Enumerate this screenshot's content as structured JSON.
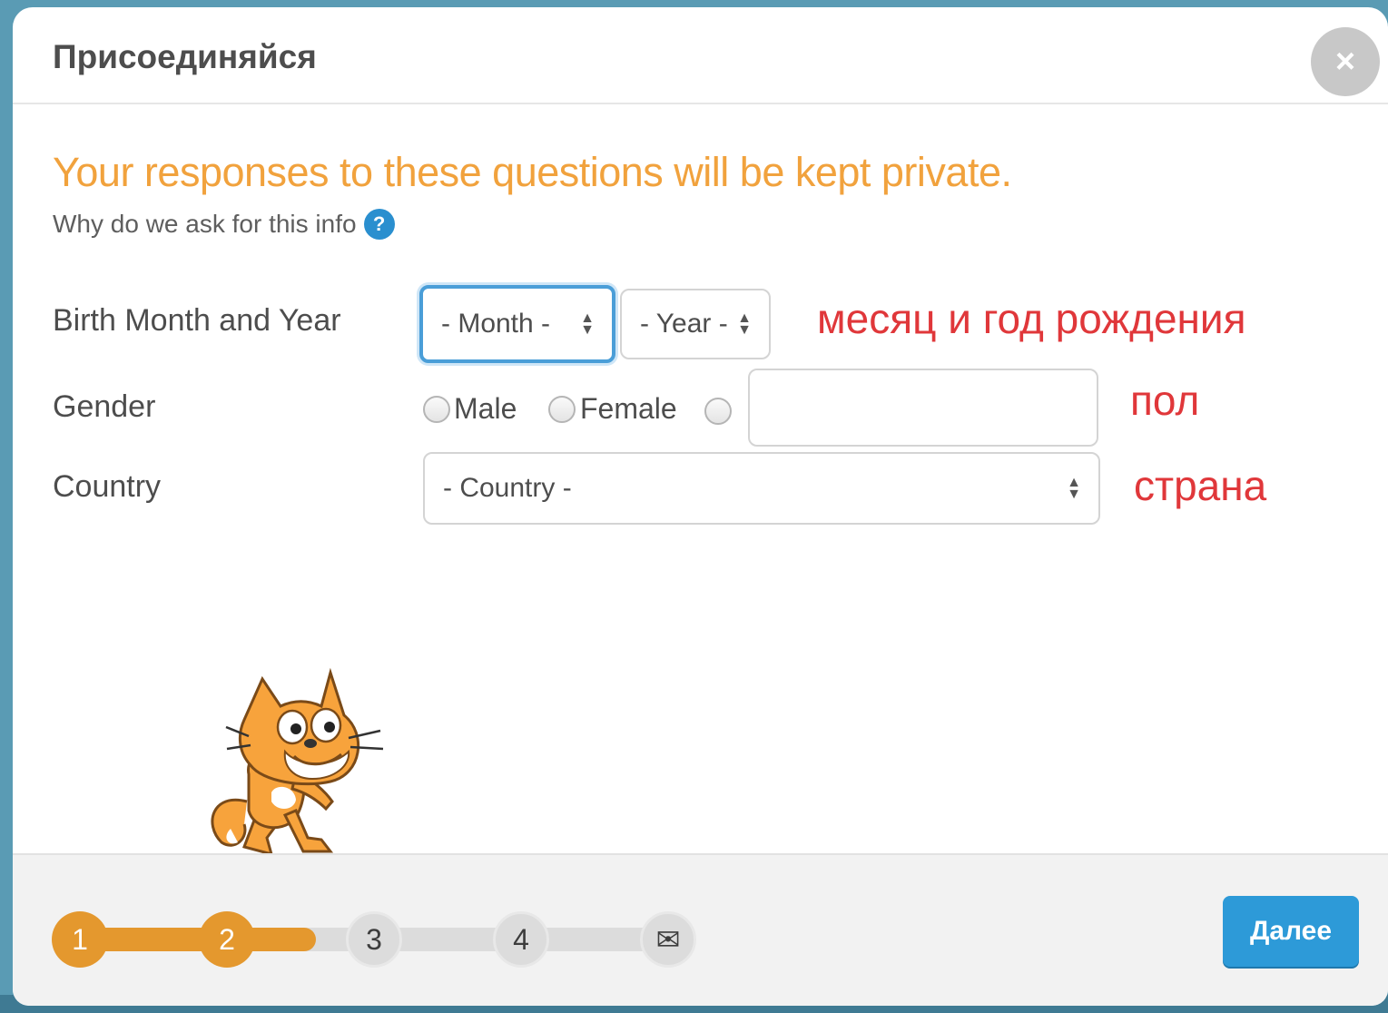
{
  "modal": {
    "title": "Присоединяйся",
    "close_glyph": "×"
  },
  "intro": {
    "headline": "Your responses to these questions will be kept private.",
    "why_text": "Why do we ask for this info",
    "help_glyph": "?"
  },
  "form": {
    "birth": {
      "label": "Birth Month and Year",
      "month_value": "- Month -",
      "year_value": "- Year -"
    },
    "gender": {
      "label": "Gender",
      "options": [
        "Male",
        "Female"
      ],
      "other_value": ""
    },
    "country": {
      "label": "Country",
      "value": "- Country -"
    }
  },
  "annotations": {
    "birth": "месяц и год рождения",
    "gender": "пол",
    "country": "страна"
  },
  "footer": {
    "steps": [
      "1",
      "2",
      "3",
      "4"
    ],
    "current_step": 2,
    "envelope_glyph": "✉",
    "next_label": "Далее"
  },
  "colors": {
    "accent_orange": "#e4982e",
    "headline_orange": "#f1a23d",
    "button_blue": "#2d9ad8",
    "annotation_red": "#e0373a"
  },
  "icons": [
    "close-icon",
    "help-icon",
    "select-arrows-icon",
    "envelope-icon",
    "scratch-cat-icon"
  ]
}
